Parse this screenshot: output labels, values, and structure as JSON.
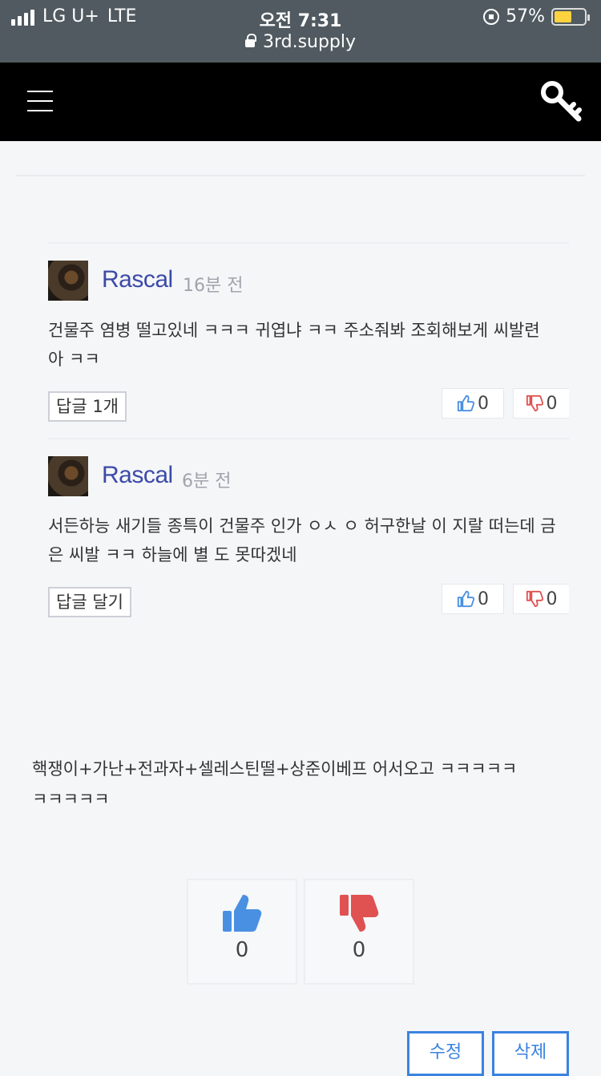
{
  "status_bar": {
    "carrier": "LG U+",
    "network": "LTE",
    "time": "오전 7:31",
    "battery": "57%",
    "battery_level": 0.57,
    "url": "3rd.supply"
  },
  "comments": [
    {
      "author": "Rascal",
      "time": "16분 전",
      "text": "건물주 염병 떨고있네 ㅋㅋㅋ 귀엽냐 ㅋㅋ 주소줘봐 조회해보게 씨발련\n아 ㅋㅋ",
      "reply_label": "답글 1개",
      "likes": "0",
      "dislikes": "0"
    },
    {
      "author": "Rascal",
      "time": "6분 전",
      "text": "서든하능 새기들 종특이 건물주 인가 ㅇㅅ ㅇ 허구한날 이 지랄 떠는데 금\n은 씨발 ㅋㅋ 하늘에 별 도 못따겠네",
      "reply_label": "답글 달기",
      "likes": "0",
      "dislikes": "0"
    }
  ],
  "post": {
    "text": "핵쟁이+가난+전과자+셀레스틴떨+상준이베프  어서오고 ㅋㅋㅋㅋㅋ\nㅋㅋㅋㅋㅋ",
    "likes": "0",
    "dislikes": "0"
  },
  "actions": {
    "edit_label": "수정",
    "delete_label": "삭제"
  },
  "colors": {
    "author": "#3c4aa8",
    "like": "#4a90e2",
    "dislike": "#e05252",
    "action": "#3b82e0"
  }
}
